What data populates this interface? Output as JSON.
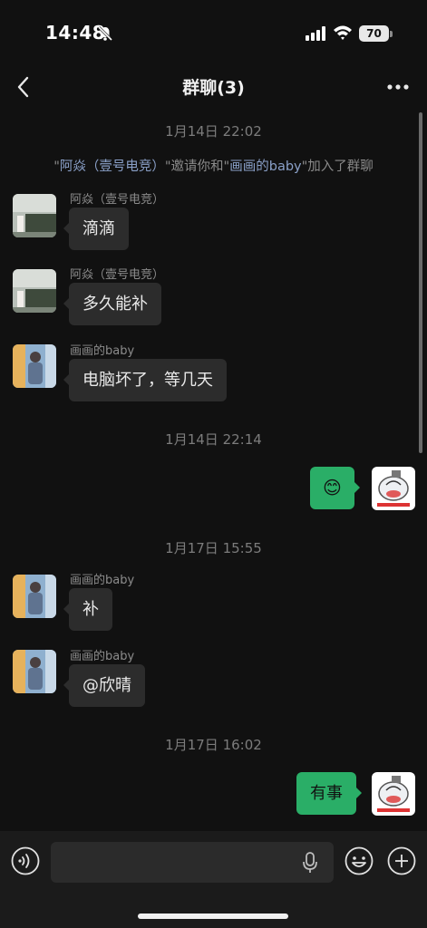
{
  "status_bar": {
    "time": "14:48",
    "battery": "70"
  },
  "nav": {
    "title": "群聊(3)"
  },
  "timestamps": [
    "1月14日 22:02",
    "1月14日 22:14",
    "1月17日 15:55",
    "1月17日 16:02"
  ],
  "system_message": {
    "q1": "\"",
    "inviter": "阿焱（壹号电竞）",
    "mid": "\"邀请你和\"",
    "invitee": "画画的baby",
    "tail": "\"加入了群聊"
  },
  "messages": [
    {
      "sender": "阿焱（壹号电竞）",
      "text": "滴滴",
      "direction": "incoming"
    },
    {
      "sender": "阿焱（壹号电竞）",
      "text": "多久能补",
      "direction": "incoming"
    },
    {
      "sender": "画画的baby",
      "text": "电脑坏了，等几天",
      "direction": "incoming"
    },
    {
      "sender": "",
      "text": "😊",
      "direction": "outgoing"
    },
    {
      "sender": "画画的baby",
      "text": "补",
      "direction": "incoming"
    },
    {
      "sender": "画画的baby",
      "text": "@欣晴",
      "direction": "incoming"
    },
    {
      "sender": "",
      "text": "有事",
      "direction": "outgoing"
    }
  ],
  "colors": {
    "outgoing_bubble": "#2aae67",
    "incoming_bubble": "#2c2c2c",
    "background": "#111111"
  }
}
